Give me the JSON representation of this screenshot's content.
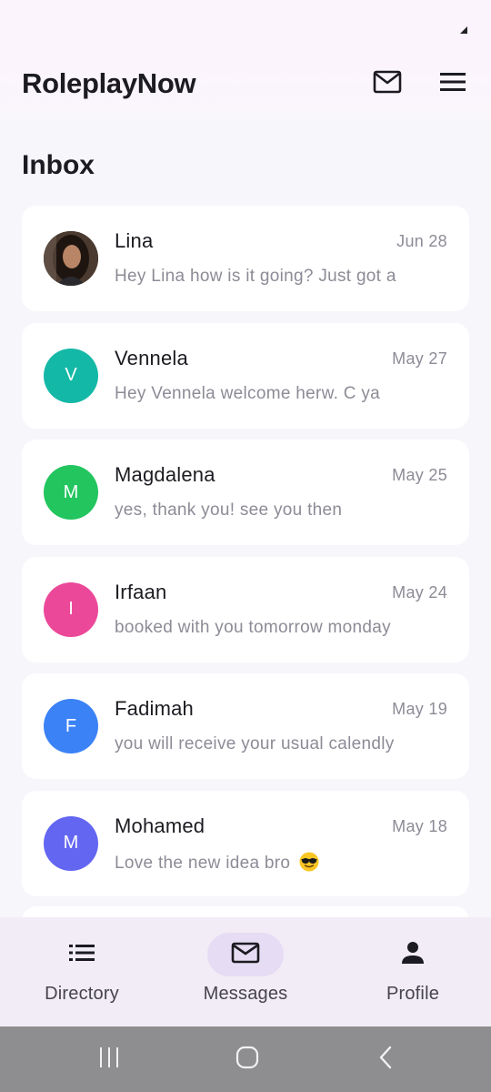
{
  "app": {
    "title": "RoleplayNow"
  },
  "header": {
    "mail_icon": "mail-icon",
    "menu_icon": "hamburger-menu-icon"
  },
  "page": {
    "title": "Inbox"
  },
  "conversations": [
    {
      "name": "Lina",
      "date": "Jun 28",
      "preview": "Hey Lina how is it going? Just got a",
      "avatar_type": "photo",
      "avatar_initial": "",
      "avatar_color": "#3a2a22"
    },
    {
      "name": "Vennela",
      "date": "May 27",
      "preview": "Hey Vennela welcome herw. C ya",
      "avatar_type": "initial",
      "avatar_initial": "V",
      "avatar_color": "#14b8a6"
    },
    {
      "name": "Magdalena",
      "date": "May 25",
      "preview": "yes, thank you! see you then",
      "avatar_type": "initial",
      "avatar_initial": "M",
      "avatar_color": "#22c55e"
    },
    {
      "name": "Irfaan",
      "date": "May 24",
      "preview": "booked with you tomorrow monday",
      "avatar_type": "initial",
      "avatar_initial": "I",
      "avatar_color": "#ec4899"
    },
    {
      "name": "Fadimah",
      "date": "May 19",
      "preview": "you will receive your usual calendly",
      "avatar_type": "initial",
      "avatar_initial": "F",
      "avatar_color": "#3b82f6"
    },
    {
      "name": "Mohamed",
      "date": "May 18",
      "preview": "Love the new idea bro",
      "preview_emoji": "smiling-face-with-sunglasses",
      "avatar_type": "initial",
      "avatar_initial": "M",
      "avatar_color": "#6366f1"
    }
  ],
  "bottom_nav": {
    "items": [
      {
        "label": "Directory",
        "icon": "list-icon",
        "active": false
      },
      {
        "label": "Messages",
        "icon": "mail-icon",
        "active": true
      },
      {
        "label": "Profile",
        "icon": "person-icon",
        "active": false
      }
    ]
  },
  "system_nav": {
    "recents_icon": "recents-icon",
    "home_icon": "home-icon",
    "back_icon": "back-icon"
  },
  "colors": {
    "accent_pill": "#e6dcf4",
    "card": "#ffffff",
    "background": "#f7f6fb"
  }
}
